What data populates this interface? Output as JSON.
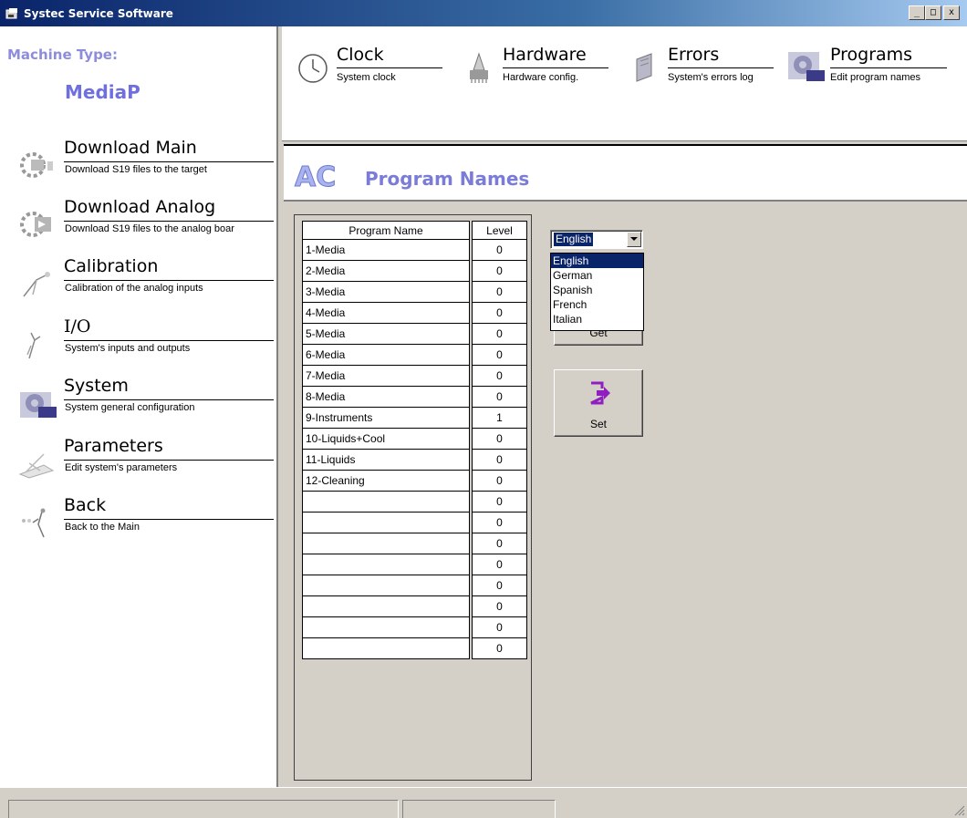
{
  "window": {
    "title": "Systec Service Software",
    "controls": {
      "minimize": "_",
      "maximize": "□",
      "close": "x"
    }
  },
  "machine": {
    "label": "Machine Type:",
    "value": "MediaP"
  },
  "sidebar": {
    "items": [
      {
        "title": "Download Main",
        "subtitle": "Download S19 files to the target",
        "icon": "download-main-icon"
      },
      {
        "title": "Download Analog",
        "subtitle": "Download S19 files to the analog boar",
        "icon": "download-analog-icon"
      },
      {
        "title": "Calibration",
        "subtitle": "Calibration of the analog inputs",
        "icon": "calibration-icon"
      },
      {
        "title": "I/O",
        "subtitle": "System's inputs and outputs",
        "icon": "io-icon"
      },
      {
        "title": "System",
        "subtitle": "System general configuration",
        "icon": "gear-icon"
      },
      {
        "title": "Parameters",
        "subtitle": "Edit system's parameters",
        "icon": "parameters-icon"
      },
      {
        "title": "Back",
        "subtitle": "Back to the Main",
        "icon": "back-icon"
      }
    ]
  },
  "toolbar": {
    "items": [
      {
        "title": "Clock",
        "subtitle": "System clock",
        "icon": "clock-icon"
      },
      {
        "title": "Hardware",
        "subtitle": "Hardware config.",
        "icon": "hardware-icon"
      },
      {
        "title": "Errors",
        "subtitle": "System's errors log",
        "icon": "errors-icon"
      },
      {
        "title": "Programs",
        "subtitle": "Edit program names",
        "icon": "gear-icon"
      }
    ]
  },
  "page": {
    "title": "Program Names",
    "logo_text": "AC"
  },
  "grid": {
    "headers": {
      "name": "Program Name",
      "level": "Level"
    },
    "rows": [
      {
        "name": "1-Media",
        "level": "0"
      },
      {
        "name": "2-Media",
        "level": "0"
      },
      {
        "name": "3-Media",
        "level": "0"
      },
      {
        "name": "4-Media",
        "level": "0"
      },
      {
        "name": "5-Media",
        "level": "0"
      },
      {
        "name": "6-Media",
        "level": "0"
      },
      {
        "name": "7-Media",
        "level": "0"
      },
      {
        "name": "8-Media",
        "level": "0"
      },
      {
        "name": "9-Instruments",
        "level": "1"
      },
      {
        "name": "10-Liquids+Cool",
        "level": "0"
      },
      {
        "name": "11-Liquids",
        "level": "0"
      },
      {
        "name": "12-Cleaning",
        "level": "0"
      },
      {
        "name": "",
        "level": "0"
      },
      {
        "name": "",
        "level": "0"
      },
      {
        "name": "",
        "level": "0"
      },
      {
        "name": "",
        "level": "0"
      },
      {
        "name": "",
        "level": "0"
      },
      {
        "name": "",
        "level": "0"
      },
      {
        "name": "",
        "level": "0"
      },
      {
        "name": "",
        "level": "0"
      }
    ]
  },
  "language": {
    "selected": "English",
    "options": [
      "English",
      "German",
      "Spanish",
      "French",
      "Italian"
    ]
  },
  "buttons": {
    "get": "Get",
    "set": "Set"
  },
  "colors": {
    "accent": "#7b7bd8",
    "titlebar": "#0a246a",
    "selection": "#0a246a"
  }
}
